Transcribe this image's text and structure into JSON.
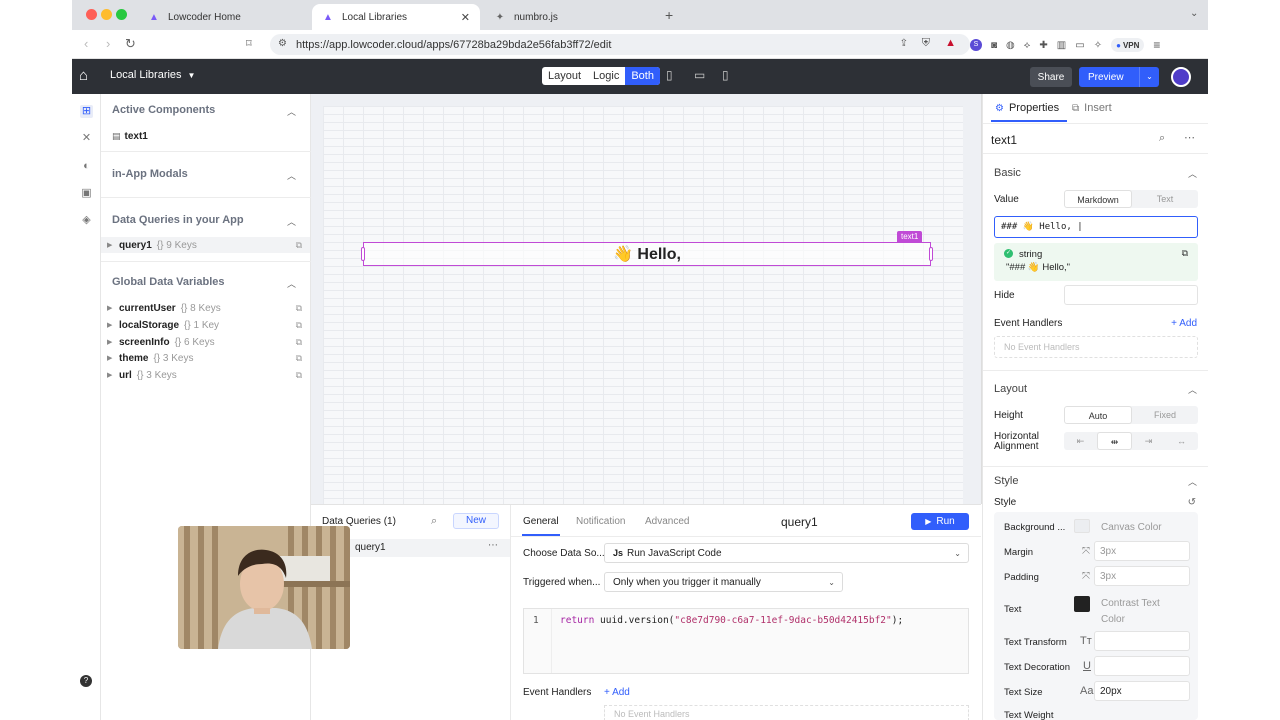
{
  "browser": {
    "tabs": [
      {
        "label": "Lowcoder Home"
      },
      {
        "label": "Local Libraries"
      },
      {
        "label": "numbro.js"
      }
    ],
    "url": "https://app.lowcoder.cloud/apps/67728ba29bda2e56fab3ff72/edit",
    "vpn_label": "VPN"
  },
  "app_header": {
    "title": "Local Libraries",
    "modes": [
      "Layout",
      "Logic",
      "Both"
    ],
    "active_mode": "Both",
    "share_label": "Share",
    "preview_label": "Preview"
  },
  "left_panel": {
    "active_components": {
      "title": "Active Components",
      "items": [
        {
          "name": "text1"
        }
      ]
    },
    "in_app_modals": {
      "title": "in-App Modals"
    },
    "data_queries": {
      "title": "Data Queries in your App",
      "items": [
        {
          "name": "query1",
          "keys": "{} 9 Keys"
        }
      ]
    },
    "global_vars": {
      "title": "Global Data Variables",
      "items": [
        {
          "name": "currentUser",
          "keys": "{} 8 Keys"
        },
        {
          "name": "localStorage",
          "keys": "{} 1 Key"
        },
        {
          "name": "screenInfo",
          "keys": "{} 6 Keys"
        },
        {
          "name": "theme",
          "keys": "{} 3 Keys"
        },
        {
          "name": "url",
          "keys": "{} 3 Keys"
        }
      ]
    }
  },
  "canvas": {
    "component_tag": "text1",
    "component_text": "👋 Hello,"
  },
  "right_panel": {
    "tabs": {
      "properties": "Properties",
      "insert": "Insert"
    },
    "component_name": "text1",
    "basic": {
      "title": "Basic",
      "value_label": "Value",
      "value_modes": [
        "Markdown",
        "Text"
      ],
      "value_mode_active": "Markdown",
      "value_input": "### 👋 Hello, |",
      "eval_type": "string",
      "eval_result": "\"### 👋 Hello,\"",
      "hide_label": "Hide",
      "event_handlers_label": "Event Handlers",
      "add_label": "+ Add",
      "no_event_handlers": "No Event Handlers"
    },
    "layout": {
      "title": "Layout",
      "height_label": "Height",
      "height_modes": [
        "Auto",
        "Fixed"
      ],
      "height_active": "Auto",
      "halign_label_1": "Horizontal",
      "halign_label_2": "Alignment"
    },
    "style": {
      "title": "Style",
      "style_label": "Style",
      "rows": {
        "background": {
          "label": "Background ...",
          "value": "Canvas Color"
        },
        "margin": {
          "label": "Margin",
          "value": "3px"
        },
        "padding": {
          "label": "Padding",
          "value": "3px"
        },
        "text": {
          "label": "Text",
          "value_1": "Contrast Text",
          "value_2": "Color"
        },
        "text_transform": {
          "label": "Text Transform"
        },
        "text_decoration": {
          "label": "Text Decoration"
        },
        "text_size": {
          "label": "Text Size",
          "value": "20px"
        },
        "text_weight": {
          "label": "Text Weight"
        }
      }
    }
  },
  "bottom_panel": {
    "list_title": "Data Queries (1)",
    "new_label": "New",
    "query_item": "query1",
    "tabs": [
      "General",
      "Notification",
      "Advanced"
    ],
    "active_tab": "General",
    "query_name": "query1",
    "run_label": "Run",
    "datasource_label": "Choose Data So...",
    "datasource_value": "Run JavaScript Code",
    "triggered_label": "Triggered when...",
    "triggered_value": "Only when you trigger it manually",
    "code_line_no": "1",
    "code_keyword": "return",
    "code_call": " uuid.version(",
    "code_string": "\"c8e7d790-c6a7-11ef-9dac-b50d42415bf2\"",
    "code_end": ");",
    "event_handlers_label": "Event Handlers",
    "add_label": "+ Add",
    "no_event_handlers": "No Event Handlers"
  },
  "colors": {
    "accent": "#315efb",
    "header_bg": "#2d3036",
    "selection": "#c04ad6"
  }
}
